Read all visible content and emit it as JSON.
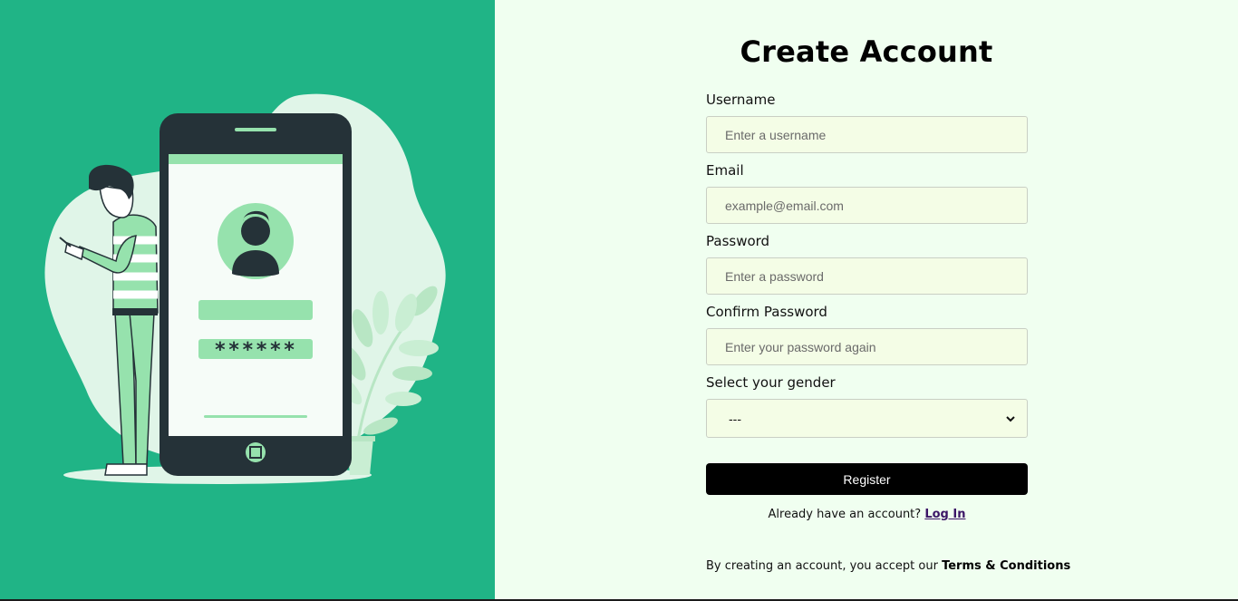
{
  "title": "Create Account",
  "form": {
    "username": {
      "label": "Username",
      "placeholder": "Enter a username"
    },
    "email": {
      "label": "Email",
      "placeholder": "example@email.com"
    },
    "password": {
      "label": "Password",
      "placeholder": "Enter a password"
    },
    "confirm_password": {
      "label": "Confirm Password",
      "placeholder": "Enter your password again"
    },
    "gender": {
      "label": "Select your gender",
      "selected": "---"
    },
    "register_label": "Register"
  },
  "login": {
    "prompt": "Already have an account?",
    "link": "Log In"
  },
  "terms": {
    "prefix": "By creating an account, you accept our",
    "link": "Terms & Conditions"
  },
  "illustration": {
    "password_mask": "******"
  },
  "colors": {
    "left_bg": "#20b486",
    "right_bg": "#f0fff0",
    "input_bg": "#f4fde6",
    "button_bg": "#000000",
    "link": "#3b1566"
  }
}
